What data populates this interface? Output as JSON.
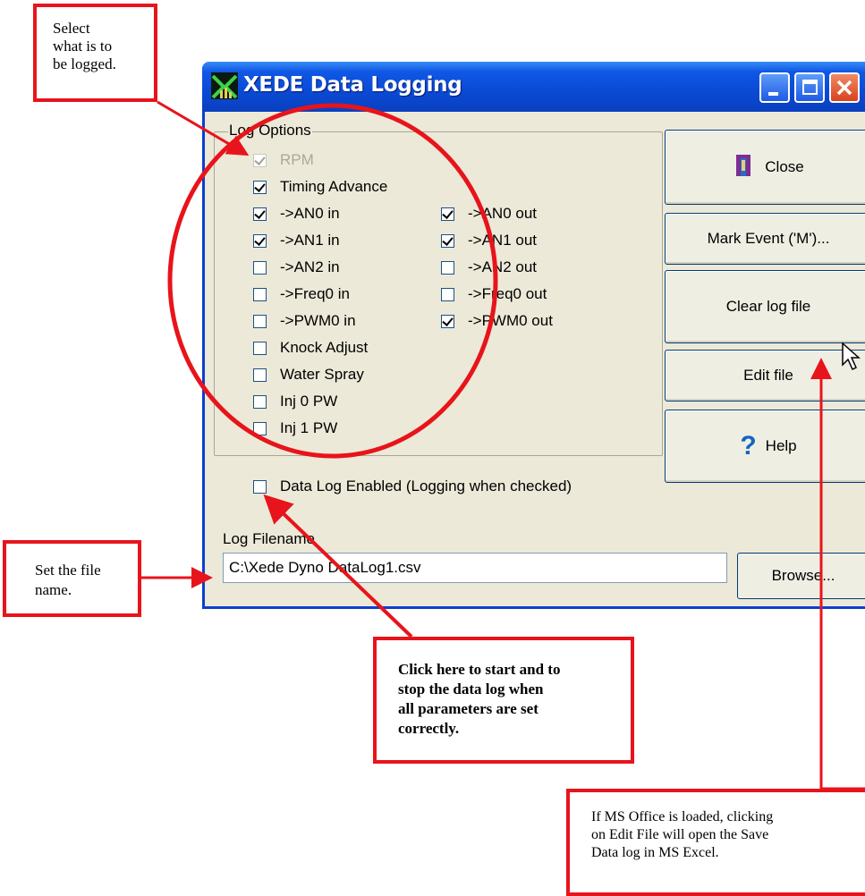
{
  "window": {
    "title": "XEDE Data Logging",
    "group_label": "Log Options",
    "options_left": [
      {
        "label": "RPM",
        "checked": true,
        "disabled": true
      },
      {
        "label": "Timing Advance",
        "checked": true,
        "disabled": false
      },
      {
        "label": "->AN0 in",
        "checked": true,
        "disabled": false
      },
      {
        "label": "->AN1 in",
        "checked": true,
        "disabled": false
      },
      {
        "label": "->AN2 in",
        "checked": false,
        "disabled": false
      },
      {
        "label": "->Freq0 in",
        "checked": false,
        "disabled": false
      },
      {
        "label": "->PWM0 in",
        "checked": false,
        "disabled": false
      },
      {
        "label": "Knock Adjust",
        "checked": false,
        "disabled": false
      },
      {
        "label": "Water Spray",
        "checked": false,
        "disabled": false
      },
      {
        "label": "Inj 0 PW",
        "checked": false,
        "disabled": false
      },
      {
        "label": "Inj 1 PW",
        "checked": false,
        "disabled": false
      }
    ],
    "options_right": [
      {
        "label": "->AN0 out",
        "checked": true
      },
      {
        "label": "->AN1 out",
        "checked": true
      },
      {
        "label": "->AN2 out",
        "checked": false
      },
      {
        "label": "->Freq0 out",
        "checked": false
      },
      {
        "label": "->PWM0 out",
        "checked": true
      }
    ],
    "enable_label": "Data Log Enabled (Logging when checked)",
    "enable_checked": false,
    "buttons": {
      "close": "Close",
      "mark": "Mark Event ('M')...",
      "clear": "Clear log file",
      "edit": "Edit file",
      "help": "Help",
      "browse": "Browse..."
    },
    "filename_label": "Log Filename",
    "filename_value": "C:\\Xede Dyno DataLog1.csv"
  },
  "callouts": {
    "select": "Select\nwhat is to\nbe logged.",
    "file": "Set the file\nname.",
    "start": "Click here to start and to\nstop the data log when\nall parameters are set\ncorrectly.",
    "office": "If MS Office is loaded, clicking\non Edit File will open the Save\nData log in MS Excel."
  },
  "colors": {
    "annotation": "#e8141b",
    "titlebar": "#0a4ad4",
    "window_bg": "#ece9d8"
  }
}
